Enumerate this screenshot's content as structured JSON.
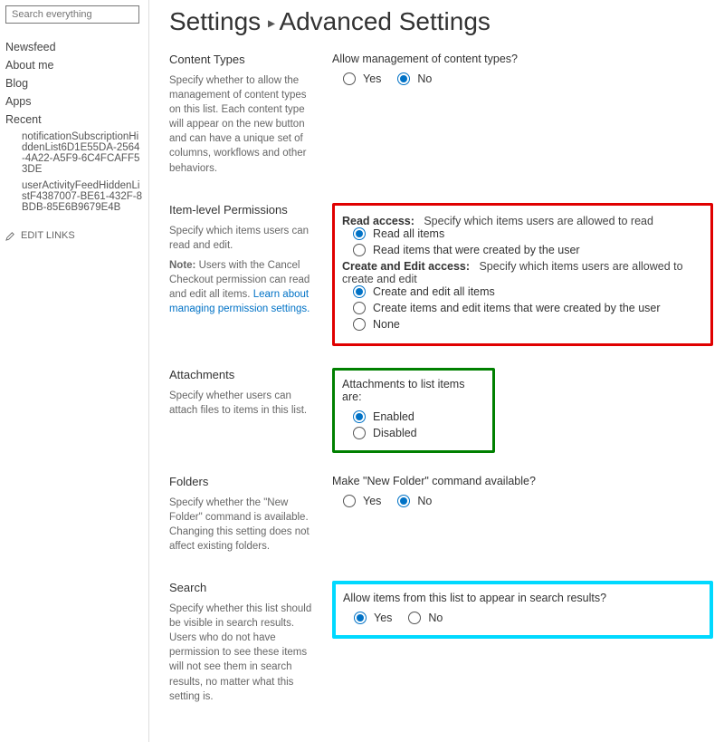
{
  "search": {
    "placeholder": "Search everything"
  },
  "nav": {
    "items": [
      "Newsfeed",
      "About me",
      "Blog",
      "Apps",
      "Recent"
    ],
    "sub": [
      "notificationSubscriptionHiddenList6D1E55DA-2564-4A22-A5F9-6C4FCAFF53DE",
      "userActivityFeedHiddenListF4387007-BE61-432F-8BDB-85E6B9679E4B"
    ],
    "edit": "EDIT LINKS"
  },
  "breadcrumb": {
    "a": "Settings",
    "b": "Advanced Settings"
  },
  "ct": {
    "h": "Content Types",
    "p": "Specify whether to allow the management of content types on this list. Each content type will appear on the new button and can have a unique set of columns, workflows and other behaviors.",
    "q": "Allow management of content types?",
    "yes": "Yes",
    "no": "No"
  },
  "perm": {
    "h": "Item-level Permissions",
    "p": "Specify which items users can read and edit.",
    "noteLabel": "Note:",
    "note": " Users with the Cancel Checkout permission can read and edit all items. ",
    "link": "Learn about managing permission settings.",
    "readHead": "Read access:",
    "readDesc": "Specify which items users are allowed to read",
    "readOpt1": "Read all items",
    "readOpt2": "Read items that were created by the user",
    "createHead": "Create and Edit access:",
    "createDesc": "Specify which items users are allowed to create and edit",
    "createOpt1": "Create and edit all items",
    "createOpt2": "Create items and edit items that were created by the user",
    "createOpt3": "None"
  },
  "att": {
    "h": "Attachments",
    "p": "Specify whether users can attach files to items in this list.",
    "q": "Attachments to list items are:",
    "opt1": "Enabled",
    "opt2": "Disabled"
  },
  "fold": {
    "h": "Folders",
    "p": "Specify whether the \"New Folder\" command is available. Changing this setting does not affect existing folders.",
    "q": "Make \"New Folder\" command available?",
    "yes": "Yes",
    "no": "No"
  },
  "srch": {
    "h": "Search",
    "p": "Specify whether this list should be visible in search results. Users who do not have permission to see these items will not see them in search results, no matter what this setting is.",
    "q": "Allow items from this list to appear in search results?",
    "yes": "Yes",
    "no": "No"
  }
}
